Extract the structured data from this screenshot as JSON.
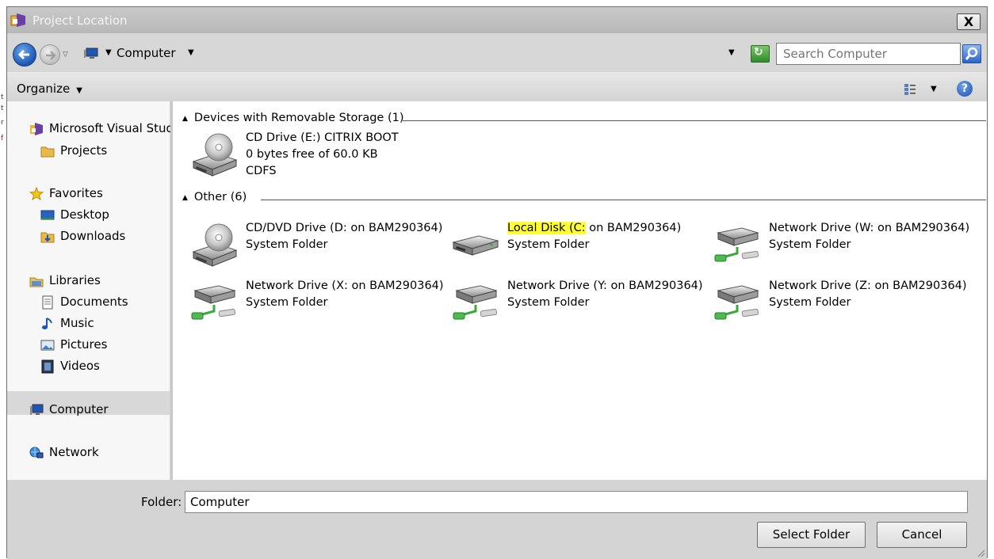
{
  "window": {
    "title": "Project Location",
    "close_label": "X"
  },
  "nav": {
    "address": "Computer",
    "search_placeholder": "Search Computer"
  },
  "toolbar": {
    "organize_label": "Organize",
    "help_label": "?"
  },
  "sidebar": {
    "microsoft_visual_studio": "Microsoft Visual Studi",
    "projects": "Projects",
    "favorites": "Favorites",
    "desktop": "Desktop",
    "downloads": "Downloads",
    "libraries": "Libraries",
    "documents": "Documents",
    "music": "Music",
    "pictures": "Pictures",
    "videos": "Videos",
    "computer": "Computer",
    "network": "Network"
  },
  "groups": {
    "removable": {
      "header": "Devices with Removable Storage (1)",
      "items": [
        {
          "name": "CD Drive (E:) CITRIX BOOT",
          "sub": "0 bytes free of 60.0 KB",
          "sub2": "CDFS",
          "icon": "cd-drive-icon"
        }
      ]
    },
    "other": {
      "header": "Other (6)",
      "items": [
        {
          "name": "CD/DVD Drive (D: on BAM290364)",
          "sub": "System Folder",
          "icon": "cd-drive-icon"
        },
        {
          "name_highlight": "Local Disk (C:",
          "name_rest": " on BAM290364)",
          "sub": "System Folder",
          "icon": "local-disk-icon"
        },
        {
          "name": "Network Drive (W: on BAM290364)",
          "sub": "System Folder",
          "icon": "network-drive-icon"
        },
        {
          "name": "Network Drive (X: on BAM290364)",
          "sub": "System Folder",
          "icon": "network-drive-icon"
        },
        {
          "name": "Network Drive (Y: on BAM290364)",
          "sub": "System Folder",
          "icon": "network-drive-icon"
        },
        {
          "name": "Network Drive (Z: on BAM290364)",
          "sub": "System Folder",
          "icon": "network-drive-icon"
        }
      ]
    }
  },
  "footer": {
    "folder_label": "Folder:",
    "folder_value": "Computer",
    "select_button": "Select Folder",
    "cancel_button": "Cancel"
  },
  "colors": {
    "highlight": "#ffff33",
    "selection": "#d8d8d8",
    "accent": "#1b56b6"
  }
}
